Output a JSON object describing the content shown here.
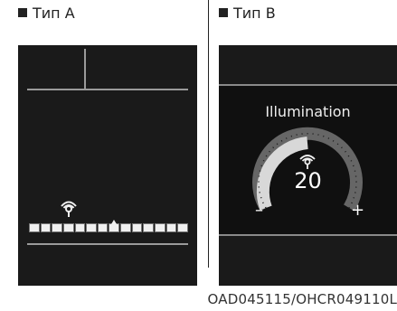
{
  "type_a": {
    "label": "Тип А",
    "level_marker_position": 0.5,
    "segments": 14
  },
  "type_b": {
    "label": "Тип B",
    "title": "Illumination",
    "value": "20",
    "minus": "–",
    "plus": "+",
    "gauge_level": 0.5
  },
  "caption": "OAD045115/OHCR049110L",
  "icons": [
    "illumination-icon"
  ]
}
